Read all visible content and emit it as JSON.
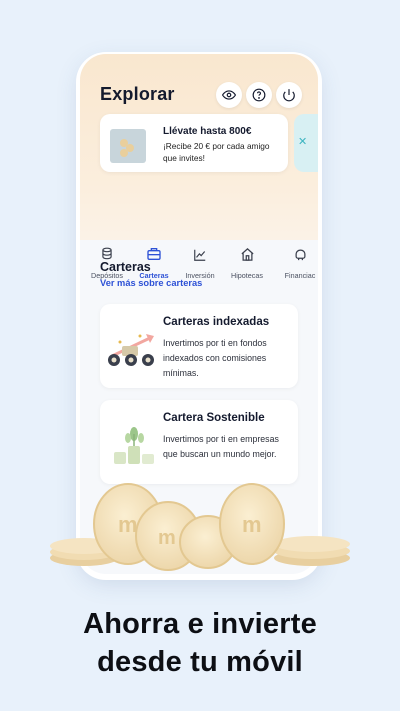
{
  "header": {
    "title": "Explorar",
    "icons": [
      "eye-icon",
      "question-icon",
      "power-icon"
    ]
  },
  "promo": {
    "title": "Llévate hasta 800€",
    "text": "¡Recibe 20 € por cada amigo que invites!"
  },
  "tabs": [
    {
      "label": "Depósitos",
      "icon": "coin-stack-icon",
      "active": false
    },
    {
      "label": "Carteras",
      "icon": "briefcase-icon",
      "active": true
    },
    {
      "label": "Inversión",
      "icon": "chart-line-icon",
      "active": false
    },
    {
      "label": "Hipotecas",
      "icon": "house-icon",
      "active": false
    },
    {
      "label": "Financiac",
      "icon": "piggy-icon",
      "active": false
    }
  ],
  "section": {
    "title": "Carteras",
    "link": "Ver más sobre carteras"
  },
  "cards": [
    {
      "title": "Carteras indexadas",
      "text": "Invertimos por ti en fondos indexados con comisiones mínimas."
    },
    {
      "title": "Cartera Sostenible",
      "text": "Invertimos por ti en empresas que buscan un mundo mejor."
    }
  ],
  "headline": {
    "line1": "Ahorra e invierte",
    "line2": "desde tu móvil"
  },
  "colors": {
    "background": "#e8f1fb",
    "accent": "#2e52d6",
    "header": "#f9e7cf",
    "coin": "#f3dfb8"
  }
}
